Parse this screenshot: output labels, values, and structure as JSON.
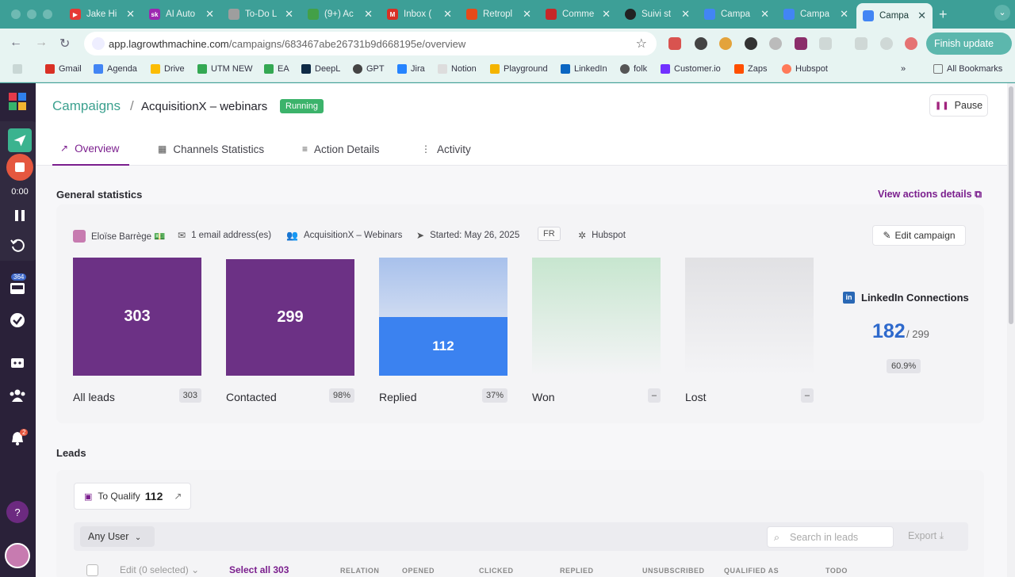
{
  "browser": {
    "tabs": [
      {
        "title": "Jake Hi",
        "fav_color": "#e53935",
        "fav_text": "▶"
      },
      {
        "title": "AI Auto",
        "fav_color": "#9c27b0",
        "fav_text": "sk"
      },
      {
        "title": "To-Do L",
        "fav_color": "#9e9e9e",
        "fav_text": ""
      },
      {
        "title": "(9+) Ac",
        "fav_color": "#43a047",
        "fav_text": ""
      },
      {
        "title": "Inbox (",
        "fav_color": "#d93025",
        "fav_text": "M"
      },
      {
        "title": "Retropl",
        "fav_color": "#e64a19",
        "fav_text": ""
      },
      {
        "title": "Comme",
        "fav_color": "#c62828",
        "fav_text": ""
      },
      {
        "title": "Suivi st",
        "fav_color": "#222222",
        "fav_text": ""
      },
      {
        "title": "Campa",
        "fav_color": "#4285f4",
        "fav_text": ""
      },
      {
        "title": "Campa",
        "fav_color": "#4285f4",
        "fav_text": ""
      },
      {
        "title": "Campa",
        "fav_color": "#4285f4",
        "fav_text": ""
      }
    ],
    "url_host": "app.lagrowthmachine.com",
    "url_path": "/campaigns/683467abe26731b9d668195e/overview",
    "finish_update": "Finish update",
    "bookmarks": [
      {
        "label": "Gmail",
        "color": "#d93025"
      },
      {
        "label": "Agenda",
        "color": "#4285f4"
      },
      {
        "label": "Drive",
        "color": "#fbbc04"
      },
      {
        "label": "UTM NEW",
        "color": "#34a853"
      },
      {
        "label": "EA",
        "color": "#34a853"
      },
      {
        "label": "DeepL",
        "color": "#0f2b46"
      },
      {
        "label": "GPT",
        "color": "#444444"
      },
      {
        "label": "Jira",
        "color": "#2684ff"
      },
      {
        "label": "Notion",
        "color": "#dddddd"
      },
      {
        "label": "Playground",
        "color": "#f4b400"
      },
      {
        "label": "LinkedIn",
        "color": "#0a66c2"
      },
      {
        "label": "folk",
        "color": "#555555"
      },
      {
        "label": "Customer.io",
        "color": "#7131ff"
      },
      {
        "label": "Zaps",
        "color": "#ff4f00"
      },
      {
        "label": "Hubspot",
        "color": "#ff7a59"
      }
    ],
    "all_bookmarks": "All Bookmarks"
  },
  "recorder": {
    "time": "0:00"
  },
  "sidebar": {
    "inbox_badge": "364",
    "notif_badge": "2",
    "help": "?"
  },
  "header": {
    "breadcrumb_root": "Campaigns",
    "breadcrumb_sep": "/",
    "campaign_name": "AcquisitionX – webinars",
    "status": "Running",
    "pause_label": "Pause"
  },
  "tabs": [
    {
      "label": "Overview",
      "icon": "trend-icon"
    },
    {
      "label": "Channels Statistics",
      "icon": "grid-icon"
    },
    {
      "label": "Action Details",
      "icon": "list-icon"
    },
    {
      "label": "Activity",
      "icon": "activity-icon"
    }
  ],
  "general": {
    "title": "General statistics",
    "view_actions": "View actions details",
    "owner": "Eloïse Barrège 💵",
    "emails": "1 email address(es)",
    "audience": "AcquisitionX – Webinars",
    "started": "Started: May 26, 2025",
    "language": "FR",
    "crm": "Hubspot",
    "edit_campaign": "Edit campaign"
  },
  "stats": [
    {
      "label": "All leads",
      "value": "303",
      "badge": "303"
    },
    {
      "label": "Contacted",
      "value": "299",
      "badge": "98%"
    },
    {
      "label": "Replied",
      "value": "112",
      "badge": "37%"
    },
    {
      "label": "Won",
      "value": "",
      "badge": "–"
    },
    {
      "label": "Lost",
      "value": "",
      "badge": "–"
    }
  ],
  "linkedin": {
    "title": "LinkedIn Connections",
    "count": "182",
    "total": "/ 299",
    "percent": "60.9%"
  },
  "leads": {
    "title": "Leads",
    "to_qualify_label": "To Qualify",
    "to_qualify_count": "112",
    "user_filter": "Any User",
    "search_placeholder": "Search in leads",
    "export": "Export",
    "edit_selected": "Edit  (0 selected)",
    "select_all": "Select all 303",
    "columns": [
      "RELATION",
      "OPENED",
      "CLICKED",
      "REPLIED",
      "UNSUBSCRIBED",
      "QUALIFIED AS",
      "TODO"
    ]
  },
  "colors": {
    "accent": "#7b1f8e",
    "brand_green": "#3ca18f",
    "running": "#3cb36b",
    "leads_box": "#6c3185",
    "replied_box": "#3b82f0"
  }
}
